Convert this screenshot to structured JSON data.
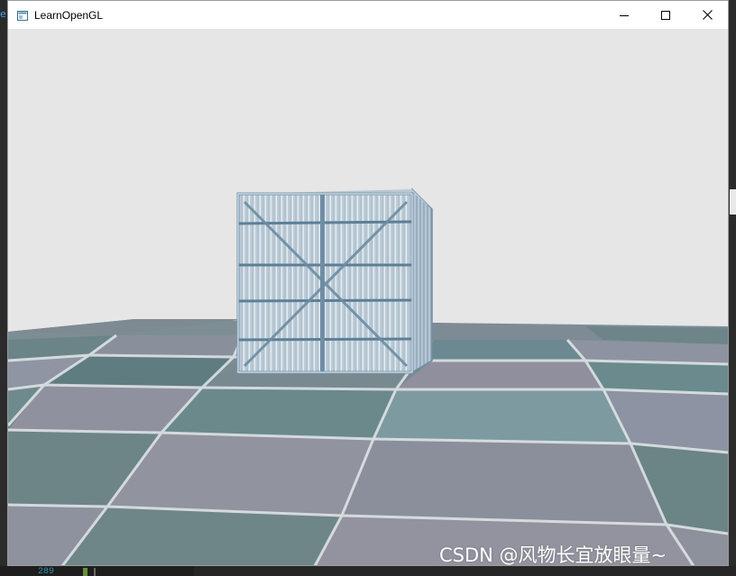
{
  "window": {
    "title": "LearnOpenGL",
    "controls": {
      "minimize": "minimize",
      "maximize": "maximize",
      "close": "close"
    }
  },
  "scene": {
    "background_color": "#e6e6e6",
    "objects": [
      "container-cube",
      "checkered-floor"
    ],
    "effect": "inverted colors"
  },
  "watermark": "CSDN @风物长宜放眼量~",
  "host": {
    "line_number": "289",
    "accent_color": "#2b91af"
  }
}
